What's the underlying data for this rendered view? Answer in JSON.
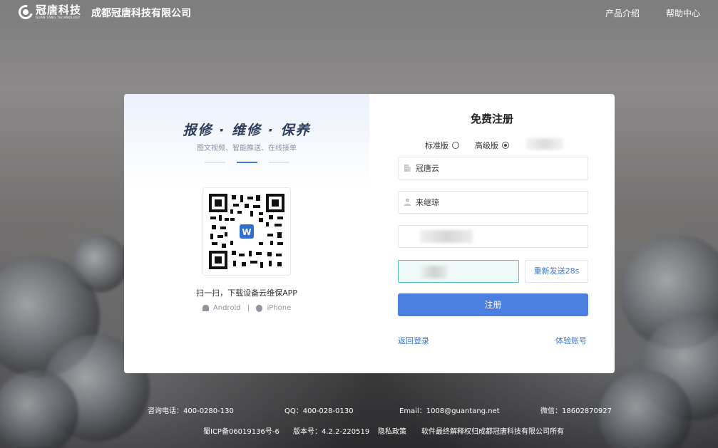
{
  "header": {
    "logo_name": "冠唐科技",
    "logo_en": "GUAN TANG TECHNOLOGY",
    "company": "成都冠唐科技有限公司",
    "nav": [
      "产品介绍",
      "帮助中心"
    ]
  },
  "promo": {
    "slogan": "报修 · 维修 · 保养",
    "subtitle": "图文视频、智能推送、在线接单",
    "qr_badge": "W",
    "scan_text": "扫一扫，下载设备云维保APP",
    "android": "Android",
    "separator": "|",
    "iphone": "iPhone"
  },
  "form": {
    "title": "免费注册",
    "editions": [
      {
        "label": "标准版",
        "checked": false
      },
      {
        "label": "高级版",
        "checked": true
      }
    ],
    "company_value": "冠唐云",
    "name_value": "来继琼",
    "resend": "重新发送28s",
    "submit": "注册",
    "back_login": "返回登录",
    "trial_account": "体验账号"
  },
  "footer": {
    "phone": "咨询电话：400-0280-130",
    "qq": "QQ：400-028-0130",
    "email": "Email：1008@guantang.net",
    "wechat": "微信：18602870927",
    "icp": "蜀ICP备06019136号-6",
    "version": "版本号：4.2.2-220519",
    "privacy": "隐私政策",
    "rights": "软件最终解释权归成都冠唐科技有限公司所有"
  },
  "colors": {
    "primary": "#4a7fe0",
    "link": "#3a77d9",
    "active_field_border": "#54c6b4"
  }
}
